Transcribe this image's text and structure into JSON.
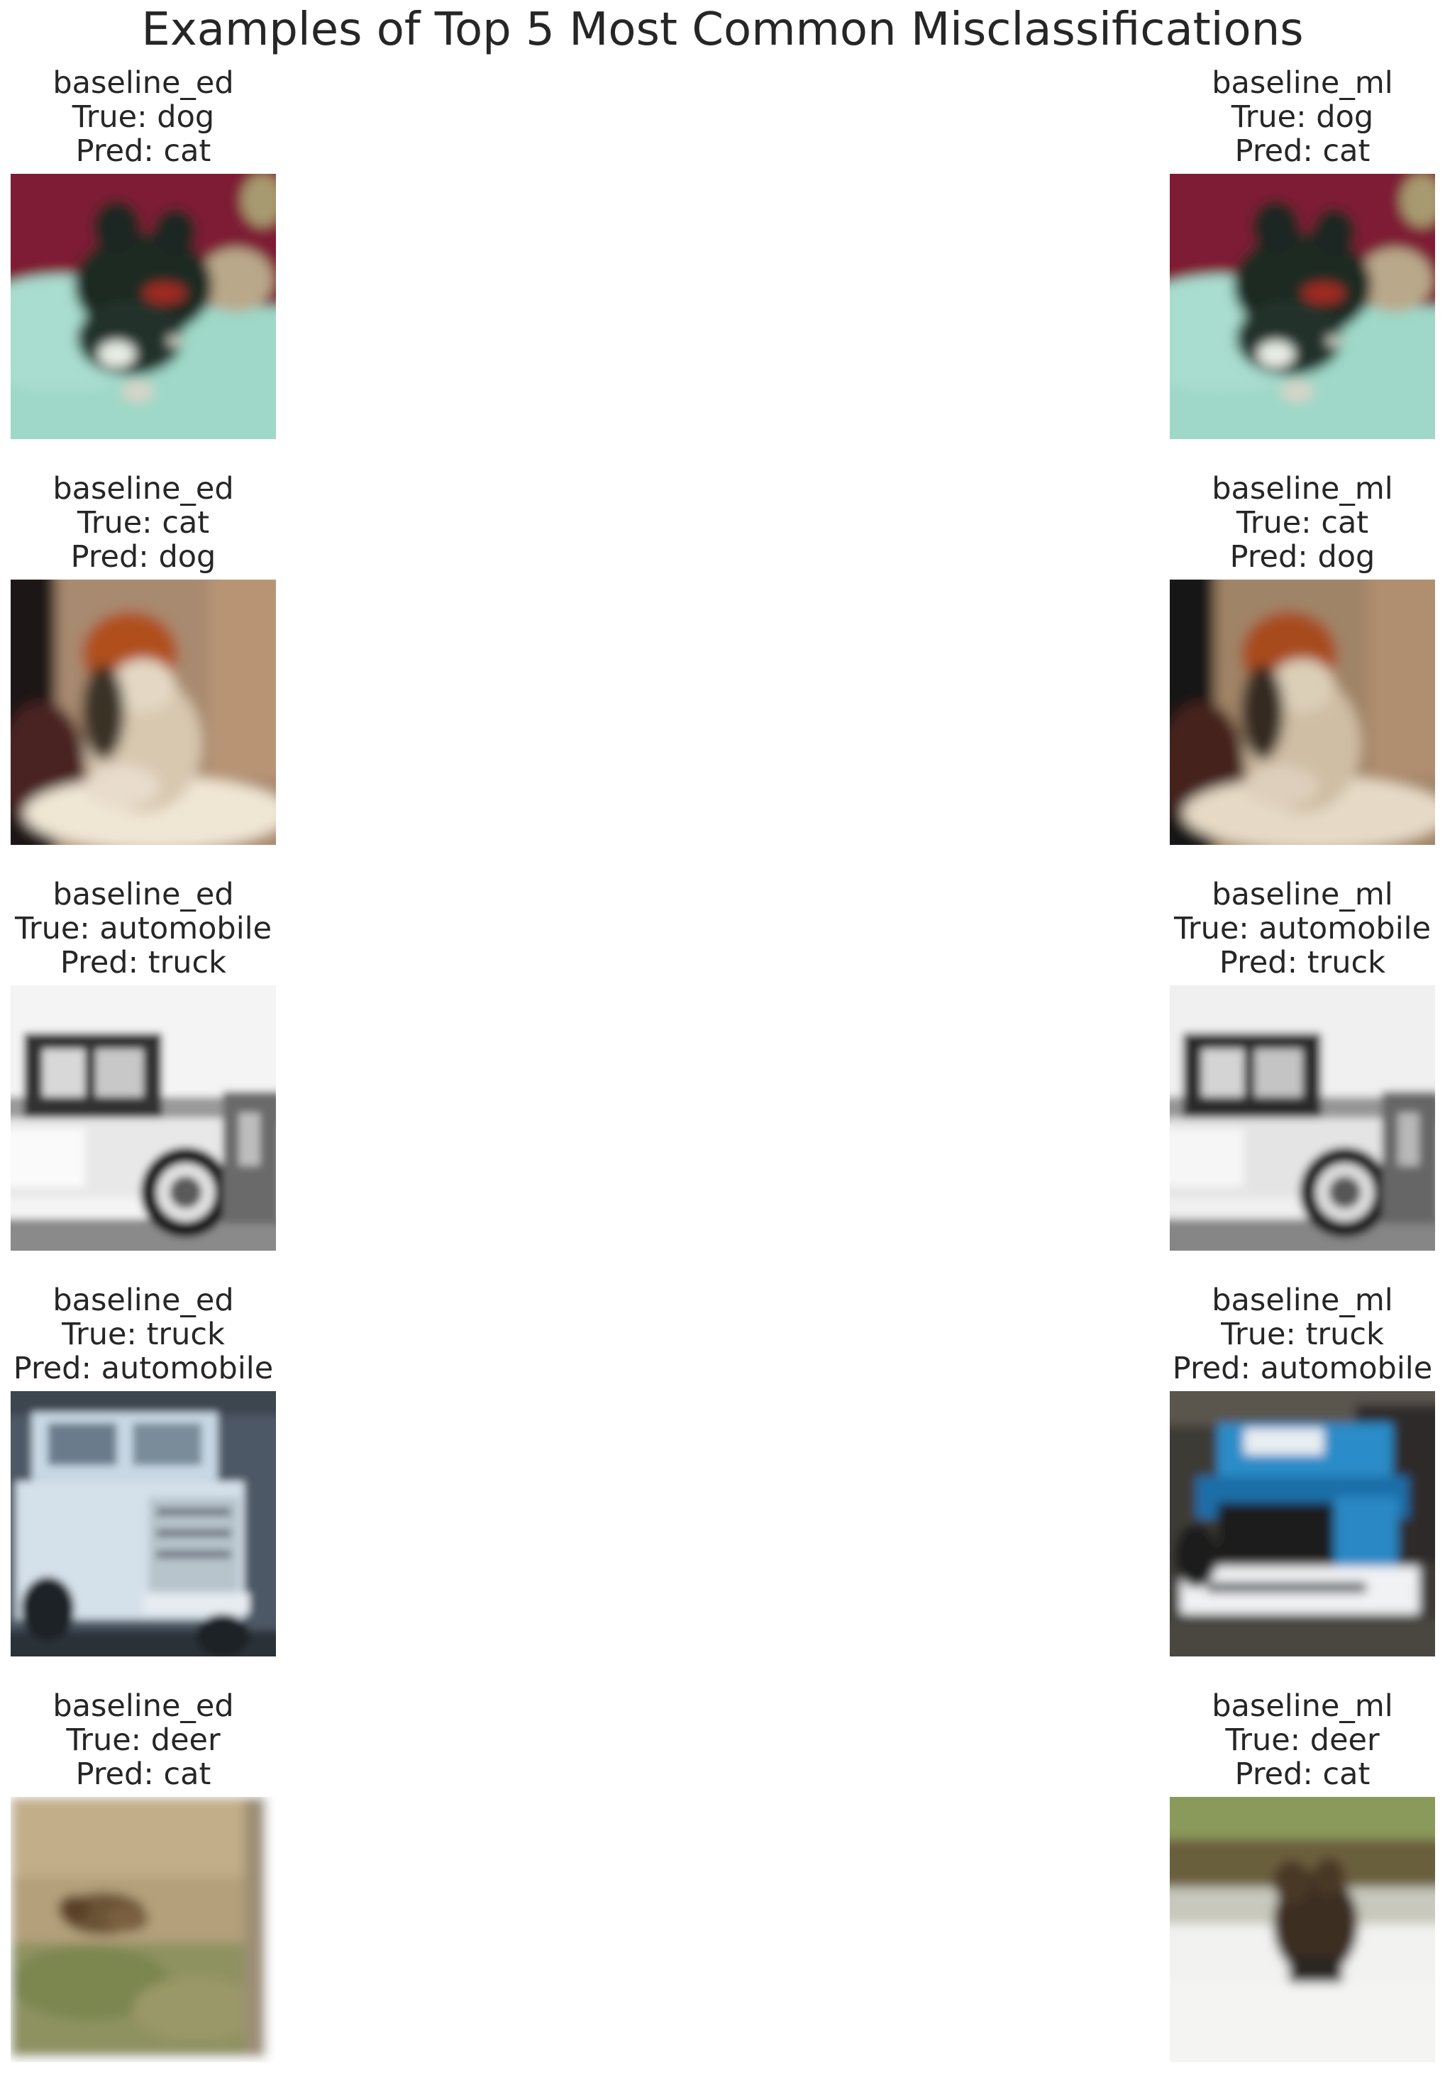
{
  "title": "Examples of Top 5 Most Common Misclassifications",
  "panels": [
    {
      "model": "baseline_ed",
      "true_label": "True: dog",
      "pred_label": "Pred: cat",
      "image": "dog-photo"
    },
    {
      "model": "baseline_ml",
      "true_label": "True: dog",
      "pred_label": "Pred: cat",
      "image": "dog-photo"
    },
    {
      "model": "baseline_ed",
      "true_label": "True: cat",
      "pred_label": "Pred: dog",
      "image": "cat-photo"
    },
    {
      "model": "baseline_ml",
      "true_label": "True: cat",
      "pred_label": "Pred: dog",
      "image": "cat-photo"
    },
    {
      "model": "baseline_ed",
      "true_label": "True: automobile",
      "pred_label": "Pred: truck",
      "image": "vintage-car-photo"
    },
    {
      "model": "baseline_ml",
      "true_label": "True: automobile",
      "pred_label": "Pred: truck",
      "image": "vintage-car-photo"
    },
    {
      "model": "baseline_ed",
      "true_label": "True: truck",
      "pred_label": "Pred: automobile",
      "image": "white-truck-photo"
    },
    {
      "model": "baseline_ml",
      "true_label": "True: truck",
      "pred_label": "Pred: automobile",
      "image": "blue-truck-photo"
    },
    {
      "model": "baseline_ed",
      "true_label": "True: deer",
      "pred_label": "Pred: cat",
      "image": "deer-in-grass-photo"
    },
    {
      "model": "baseline_ml",
      "true_label": "True: deer",
      "pred_label": "Pred: cat",
      "image": "deer-in-water-photo"
    }
  ]
}
